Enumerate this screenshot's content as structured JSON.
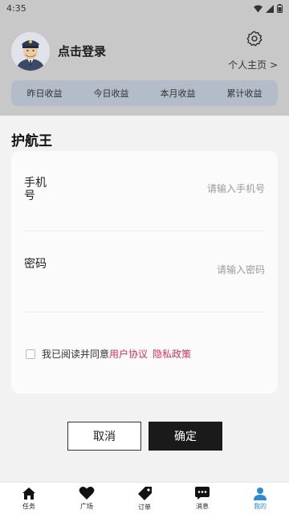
{
  "status_bar": {
    "time": "4:35"
  },
  "header": {
    "login_text": "点击登录",
    "profile_link": "个人主页 >",
    "stats": [
      "昨日收益",
      "今日收益",
      "本月收益",
      "累计收益"
    ]
  },
  "login_sheet": {
    "title": "护航王",
    "phone_label": "手机号",
    "phone_placeholder": "请输入手机号",
    "password_label": "密码",
    "password_placeholder": "请输入密码",
    "agree_text": "我已阅读并同意",
    "user_agreement": "用户协议",
    "privacy_policy": "隐私政策",
    "cancel_label": "取消",
    "confirm_label": "确定"
  },
  "bottom_nav": {
    "items": [
      {
        "label": "任务",
        "icon": "home-icon"
      },
      {
        "label": "广场",
        "icon": "heart-icon"
      },
      {
        "label": "订单",
        "icon": "tag-icon"
      },
      {
        "label": "消息",
        "icon": "chat-icon"
      },
      {
        "label": "我的",
        "icon": "user-icon"
      }
    ],
    "active_index": 4
  },
  "colors": {
    "accent_link": "#d9305a",
    "nav_active": "#2a8ad8",
    "confirm_bg": "#1a1a1a"
  }
}
